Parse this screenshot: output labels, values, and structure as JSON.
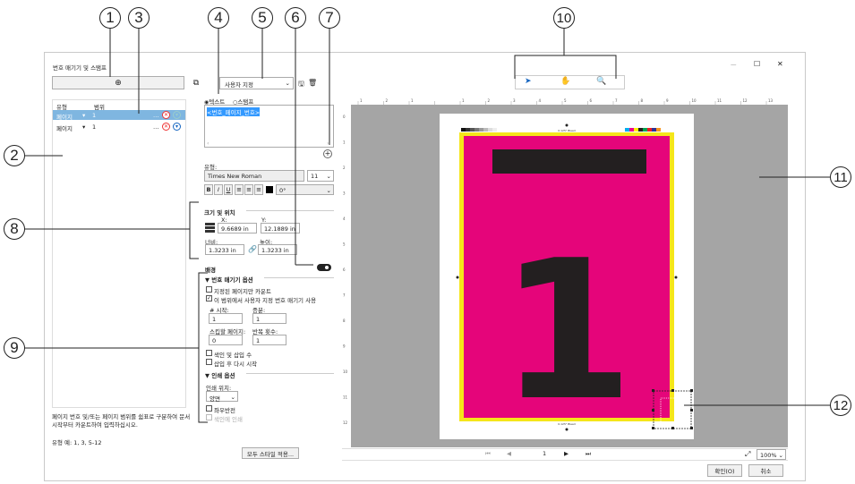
{
  "callouts": [
    "1",
    "2",
    "3",
    "4",
    "5",
    "6",
    "7",
    "8",
    "9",
    "10",
    "11",
    "12"
  ],
  "window": {
    "title": "번호 매기기 및 스탬프",
    "minimize": "—",
    "maximize": "☐",
    "close": "✕"
  },
  "left": {
    "col_type": "유형",
    "col_range": "범위",
    "rows": [
      {
        "type": "페이지",
        "range": "1",
        "selected": true
      },
      {
        "type": "페이지",
        "range": "1",
        "selected": false
      }
    ],
    "help_text": "페이지 번호 및/또는 페이지 범위를 쉼표로 구분하여 문서 시작부터 카운트하여 입력하십시오.",
    "help_example": "유형 예: 1, 3, 5-12"
  },
  "mid": {
    "preset": "사용자 지정",
    "radio_text": "텍스트",
    "radio_stamp": "스탬프",
    "text_value": "<번호_페이지_번호>",
    "type_label": "유형:",
    "font": "Times New Roman",
    "font_size": "11",
    "bold": "B",
    "italic": "I",
    "underline": "U",
    "rotation": "0°",
    "size_pos_title": "크기 및 위치",
    "x_label": "X:",
    "x_value": "9.6689 in",
    "y_label": "Y:",
    "y_value": "12.1889 in",
    "w_label": "너비:",
    "w_value": "1.3233 in",
    "h_label": "높이:",
    "h_value": "1.3233 in",
    "background_label": "배경",
    "numbering_title": "번호 매기기 옵션",
    "opt_selected_only": "지정된 페이지만 카운트",
    "opt_custom": "이 범위에서 사용자 지정 번호 매기기 사용",
    "start_label": "# 시작:",
    "start_value": "1",
    "inc_label": "증분:",
    "inc_value": "1",
    "skip_label": "스킵할 페이지:",
    "skip_value": "0",
    "repeat_label": "반복 횟수:",
    "repeat_value": "1",
    "opt_tabs": "색인 및 삽입 수",
    "opt_restart": "삽입 후 다시 시작",
    "print_title": "인쇄 옵션",
    "print_pos_label": "인쇄 위치:",
    "print_pos_value": "양면",
    "opt_mirror": "좌우반전",
    "opt_tab_print": "색인에 인쇄",
    "apply_all": "모두 스타일 적용..."
  },
  "preview": {
    "ruler_top": [
      "1",
      "2",
      "1",
      "",
      "1",
      "2",
      "3",
      "4",
      "5",
      "6",
      "7",
      "8",
      "9",
      "10",
      "11",
      "12",
      "13"
    ],
    "ruler_left": [
      "0",
      "1",
      "2",
      "3",
      "4",
      "5",
      "6",
      "7",
      "8",
      "9",
      "10",
      "11",
      "12"
    ],
    "page_number": "1",
    "page_field": "1",
    "zoom": "100%",
    "crop_label": "0.125\" Bleed",
    "colors": {
      "page": "#e5057a",
      "bleed": "#f5e61a",
      "bar": "#231f20",
      "gray": "#a5a5a5"
    }
  },
  "footer": {
    "ok": "확인(O)",
    "cancel": "취소"
  }
}
